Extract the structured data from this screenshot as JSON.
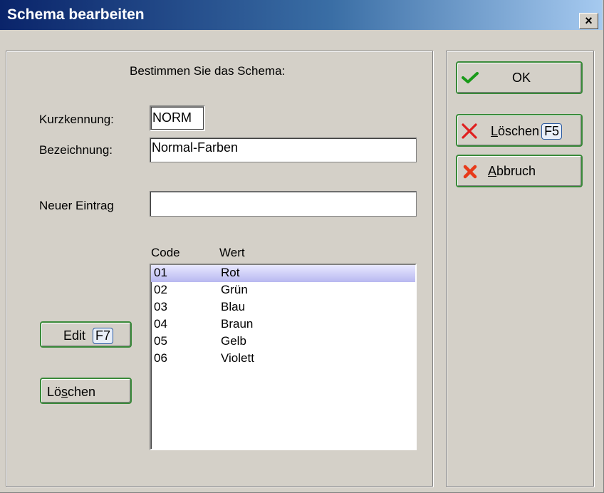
{
  "window": {
    "title": "Schema bearbeiten",
    "close_label": "×"
  },
  "header": {
    "instruction": "Bestimmen Sie das Schema:"
  },
  "fields": {
    "kurzkennung_label": "Kurzkennung:",
    "kurzkennung_value": "NORM",
    "bezeichnung_label": "Bezeichnung:",
    "bezeichnung_value": "Normal-Farben",
    "neuer_eintrag_label": "Neuer Eintrag",
    "neuer_eintrag_value": ""
  },
  "list": {
    "columns": [
      "Code",
      "Wert"
    ],
    "rows": [
      {
        "code": "01",
        "wert": "Rot"
      },
      {
        "code": "02",
        "wert": "Grün"
      },
      {
        "code": "03",
        "wert": "Blau"
      },
      {
        "code": "04",
        "wert": "Braun"
      },
      {
        "code": "05",
        "wert": "Gelb"
      },
      {
        "code": "06",
        "wert": "Violett"
      }
    ],
    "selected_index": 0
  },
  "buttons": {
    "edit_label": "Edit",
    "edit_key": "F7",
    "loeschen_left_pre": "Lö",
    "loeschen_left_u": "s",
    "loeschen_left_post": "chen",
    "ok_label": "OK",
    "loeschen_right_u": "L",
    "loeschen_right_post": "öschen",
    "loeschen_right_key": "F5",
    "abbruch_u": "A",
    "abbruch_post": "bbruch"
  },
  "colors": {
    "accent_green": "#3a8a3a",
    "title_start": "#0a246a",
    "title_end": "#a6caf0",
    "selection": "#b8b8f0"
  }
}
